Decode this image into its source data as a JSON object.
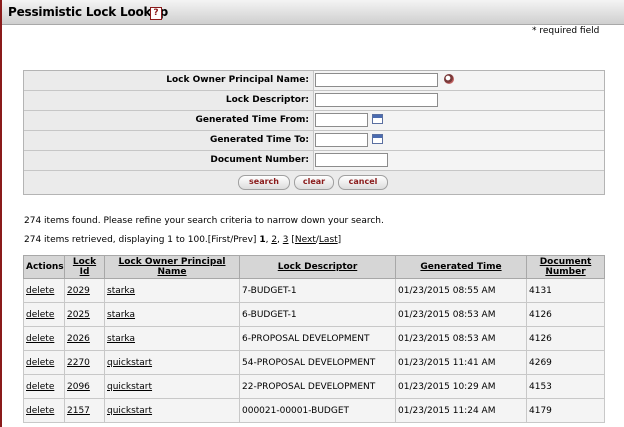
{
  "page": {
    "title": "Pessimistic Lock Lookup",
    "help_icon": "help-icon",
    "required_note": "* required field"
  },
  "search": {
    "fields": [
      {
        "label": "Lock Owner Principal Name:",
        "value": "",
        "icon": "lookup-icon"
      },
      {
        "label": "Lock Descriptor:",
        "value": ""
      },
      {
        "label": "Generated Time From:",
        "value": "",
        "icon": "calendar-icon"
      },
      {
        "label": "Generated Time To:",
        "value": "",
        "icon": "calendar-icon"
      },
      {
        "label": "Document Number:",
        "value": ""
      }
    ],
    "buttons": {
      "search": "search",
      "clear": "clear",
      "cancel": "cancel"
    }
  },
  "results": {
    "found_msg": "274 items found.  Please refine your search criteria to narrow down your search.",
    "retrieved_msg": "274 items retrieved, displaying 1 to 100.",
    "pager": {
      "first_prev": "[First/Prev]",
      "p1": "1",
      "p2": "2",
      "p3": "3",
      "open": "[",
      "next_last": "Next/Last",
      "close": "]",
      "sep_slash": "/",
      "next": "Next",
      "last": "Last"
    },
    "columns": [
      "Actions",
      "Lock Id",
      "Lock Owner Principal Name",
      "Lock Descriptor",
      "Generated Time",
      "Document Number"
    ],
    "rows": [
      {
        "action": "delete",
        "id": "2029",
        "owner": "starka",
        "descriptor": "7-BUDGET-1",
        "time": "01/23/2015 08:55 AM",
        "doc": "4131"
      },
      {
        "action": "delete",
        "id": "2025",
        "owner": "starka",
        "descriptor": "6-BUDGET-1",
        "time": "01/23/2015 08:53 AM",
        "doc": "4126"
      },
      {
        "action": "delete",
        "id": "2026",
        "owner": "starka",
        "descriptor": "6-PROPOSAL DEVELOPMENT",
        "time": "01/23/2015 08:53 AM",
        "doc": "4126"
      },
      {
        "action": "delete",
        "id": "2270",
        "owner": "quickstart",
        "descriptor": "54-PROPOSAL DEVELOPMENT",
        "time": "01/23/2015 11:41 AM",
        "doc": "4269"
      },
      {
        "action": "delete",
        "id": "2096",
        "owner": "quickstart",
        "descriptor": "22-PROPOSAL DEVELOPMENT",
        "time": "01/23/2015 10:29 AM",
        "doc": "4153"
      },
      {
        "action": "delete",
        "id": "2157",
        "owner": "quickstart",
        "descriptor": "000021-00001-BUDGET",
        "time": "01/23/2015 11:24 AM",
        "doc": "4179"
      }
    ]
  }
}
